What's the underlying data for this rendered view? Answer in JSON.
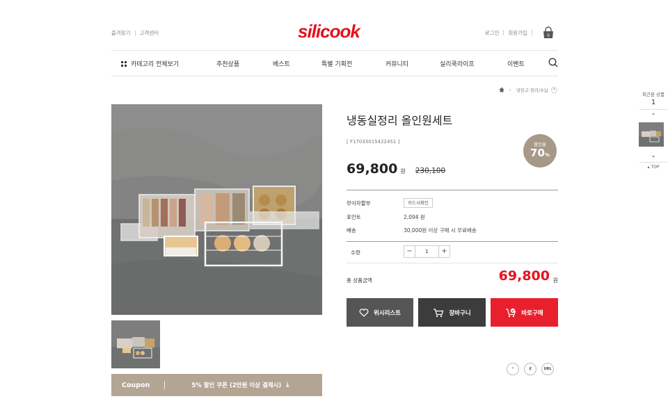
{
  "header": {
    "bookmark": "즐겨찾기",
    "customer_center": "고객센터",
    "brand": "silicook",
    "login": "로그인",
    "signup": "회원가입",
    "cart_count": "0"
  },
  "nav": {
    "all_categories": "카테고리 전체보기",
    "items": [
      "추천상품",
      "베스트",
      "특별 기획전",
      "커뮤니티",
      "실리쿡라이프",
      "이벤트"
    ]
  },
  "breadcrumb": {
    "current": "냉장고 정리/수납"
  },
  "product": {
    "title": "냉동실정리 올인원세트",
    "code": "[ F170330154224S1 ]",
    "discount_label": "할인율",
    "discount_value": "70",
    "discount_unit": "%",
    "price": "69,800",
    "price_unit": "원",
    "original_price": "230,100",
    "installment_label": "무이자할부",
    "card_button": "카드사확인",
    "point_label": "포인트",
    "point_value": "2,094 원",
    "shipping_label": "배송",
    "shipping_value": "30,000원 이상 구매 시 무료배송",
    "qty_label": "수량",
    "qty_value": "1",
    "total_label": "총 상품금액",
    "total_value": "69,800",
    "total_unit": "원"
  },
  "buttons": {
    "wishlist": "위시리스트",
    "cart": "장바구니",
    "buy": "바로구매"
  },
  "coupon": {
    "label": "Coupon",
    "text": "5% 할인 쿠폰 (2만원 이상 결제시)"
  },
  "share": {
    "url": "URL"
  },
  "recent": {
    "label": "최근본 상품",
    "count": "1",
    "top": "TOP"
  },
  "colors": {
    "brand_red": "#e4131d",
    "buy_button": "#e8202d",
    "coupon_bg": "#b4a494",
    "discount_badge": "#a89888"
  }
}
